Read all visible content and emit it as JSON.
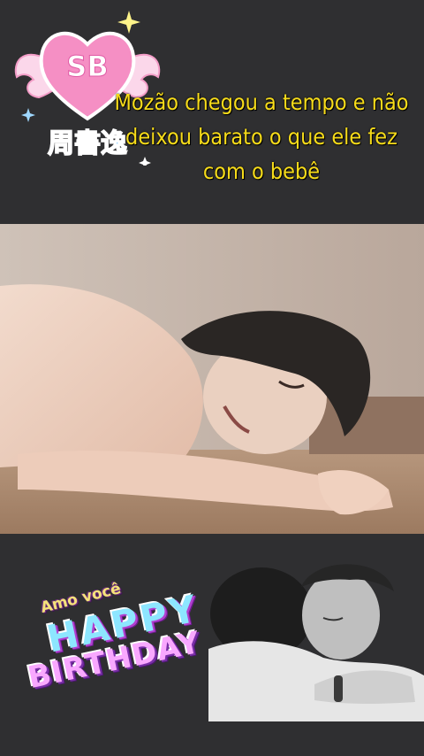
{
  "logo": {
    "badge_text": "SB",
    "subtitle_text": "周書逸"
  },
  "caption": {
    "lines": [
      "Mozão chegou a tempo e não",
      "deixou barato o que ele fez",
      "com o bebê"
    ]
  },
  "sticker": {
    "small_text": "Amo você",
    "line1": "HAPPY",
    "line2": "BIRTHDAY"
  },
  "colors": {
    "background": "#2f2f31",
    "caption": "#f7dc1a",
    "logo_heart": "#f58fc4",
    "logo_wings": "#f6b6d9"
  },
  "icons": [
    "heart-logo-icon",
    "wing-icon",
    "sparkle-icon"
  ]
}
